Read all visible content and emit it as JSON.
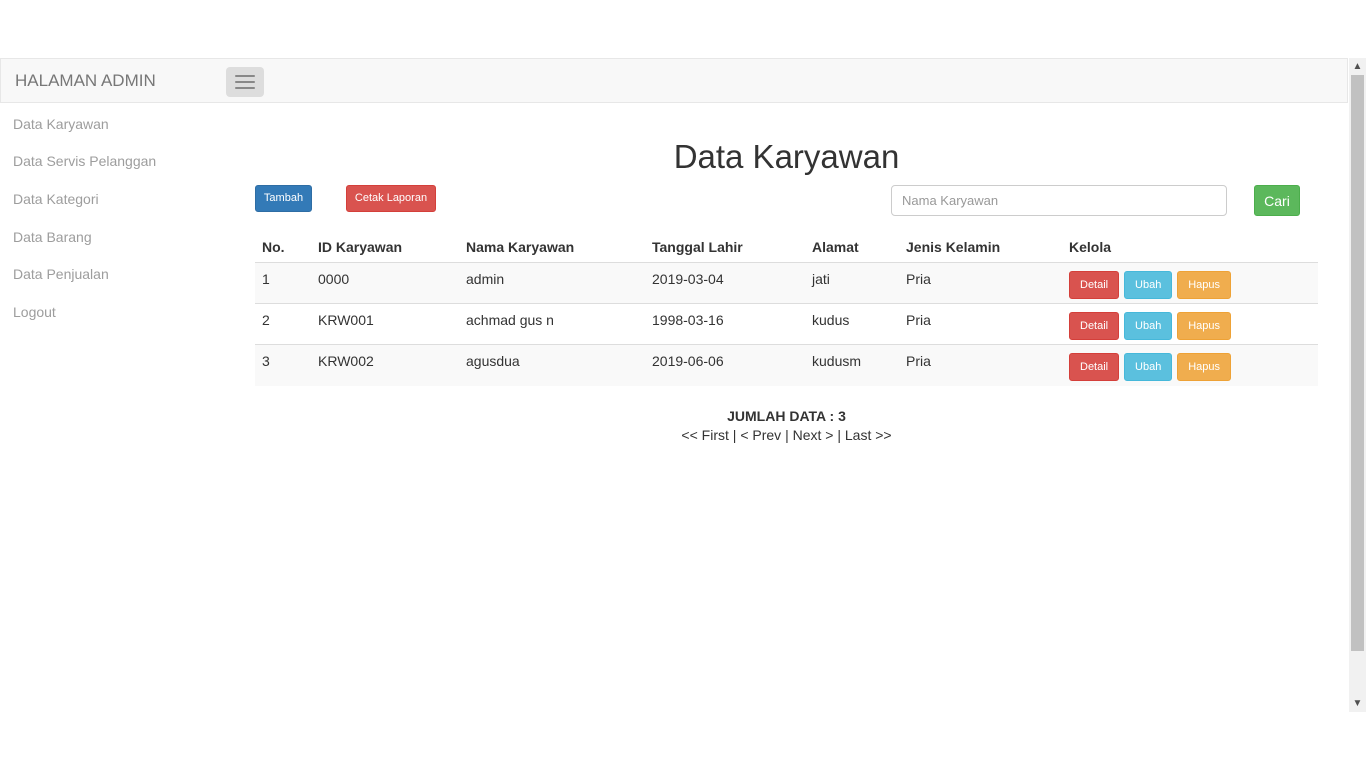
{
  "navbar": {
    "brand": "HALAMAN ADMIN"
  },
  "sidebar": {
    "items": [
      {
        "label": "Data Karyawan"
      },
      {
        "label": "Data Servis Pelanggan"
      },
      {
        "label": "Data Kategori"
      },
      {
        "label": "Data Barang"
      },
      {
        "label": "Data Penjualan"
      },
      {
        "label": "Logout"
      }
    ]
  },
  "main": {
    "title": "Data Karyawan",
    "toolbar": {
      "add_label": "Tambah",
      "print_label": "Cetak Laporan",
      "search_button": "Cari"
    },
    "search": {
      "placeholder": "Nama Karyawan",
      "value": ""
    },
    "table": {
      "headers": [
        "No.",
        "ID Karyawan",
        "Nama Karyawan",
        "Tanggal Lahir",
        "Alamat",
        "Jenis Kelamin",
        "Kelola"
      ],
      "rows": [
        {
          "no": "1",
          "id": "0000",
          "nama": "admin",
          "tanggal_lahir": "2019-03-04",
          "alamat": "jati",
          "jenis_kelamin": "Pria"
        },
        {
          "no": "2",
          "id": "KRW001",
          "nama": "achmad gus n",
          "tanggal_lahir": "1998-03-16",
          "alamat": "kudus",
          "jenis_kelamin": "Pria"
        },
        {
          "no": "3",
          "id": "KRW002",
          "nama": "agusdua",
          "tanggal_lahir": "2019-06-06",
          "alamat": "kudusm",
          "jenis_kelamin": "Pria"
        }
      ],
      "actions": {
        "detail": "Detail",
        "edit": "Ubah",
        "delete": "Hapus"
      }
    },
    "summary": {
      "total_label": "JUMLAH DATA : 3",
      "pagination": {
        "first": "<< First",
        "prev": "< Prev",
        "next": "Next >",
        "last": "Last >>",
        "separator": "|"
      }
    }
  },
  "scrollbar": {
    "up_icon": "▲",
    "down_icon": "▼"
  },
  "colors": {
    "primary": "#337ab7",
    "danger": "#d9534f",
    "info": "#5bc0de",
    "warning": "#f0ad4e",
    "success": "#5cb85c",
    "navbar_bg": "#f8f8f8"
  }
}
